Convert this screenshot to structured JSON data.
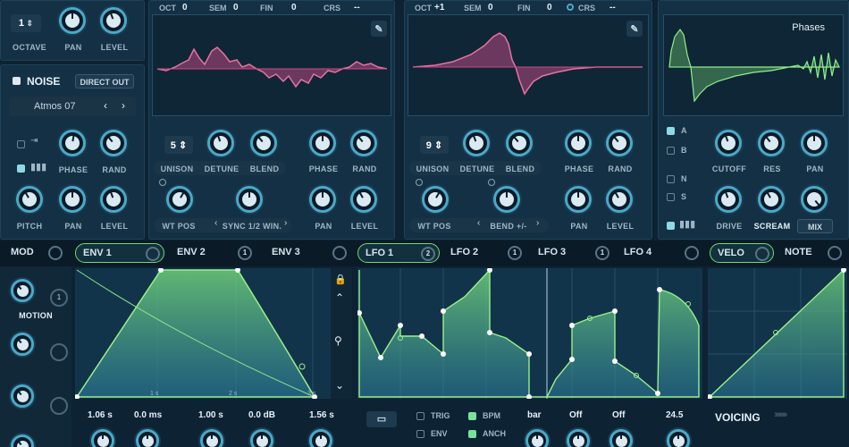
{
  "top_left": {
    "octave_value": "1",
    "octave_label": "OCTAVE",
    "pan_label": "PAN",
    "level_label": "LEVEL",
    "noise_label": "NOISE",
    "direct_out_label": "DIRECT OUT",
    "preset_name": "Atmos 07",
    "phase_label": "PHASE",
    "rand_label": "RAND",
    "pitch_label": "PITCH",
    "pan2_label": "PAN",
    "level2_label": "LEVEL"
  },
  "osc_a": {
    "oct_label": "OCT",
    "oct_value": "0",
    "sem_label": "SEM",
    "sem_value": "0",
    "fin_label": "FIN",
    "fin_value": "0",
    "crs_label": "CRS",
    "crs_value": "--",
    "unison_value": "5",
    "unison_label": "UNISON",
    "detune_label": "DETUNE",
    "blend_label": "BLEND",
    "phase_label": "PHASE",
    "rand_label": "RAND",
    "wt_pos_label": "WT POS",
    "warp_label": "SYNC 1/2 WIN.",
    "pan_label": "PAN",
    "level_label": "LEVEL"
  },
  "osc_b": {
    "oct_label": "OCT",
    "oct_value": "+1",
    "sem_label": "SEM",
    "sem_value": "0",
    "fin_label": "FIN",
    "fin_value": "0",
    "crs_label": "CRS",
    "crs_value": "--",
    "unison_value": "9",
    "unison_label": "UNISON",
    "detune_label": "DETUNE",
    "blend_label": "BLEND",
    "phase_label": "PHASE",
    "rand_label": "RAND",
    "wt_pos_label": "WT POS",
    "warp_label": "BEND +/-",
    "pan_label": "PAN",
    "level_label": "LEVEL"
  },
  "filter": {
    "title": "Phases",
    "a_label": "A",
    "b_label": "B",
    "n_label": "N",
    "s_label": "S",
    "cutoff_label": "CUTOFF",
    "res_label": "RES",
    "pan_label": "PAN",
    "drive_label": "DRIVE",
    "scream_label": "SCREAM",
    "mix_label": "MIX"
  },
  "mod_tabs": [
    {
      "label": "MOD",
      "badge": ""
    },
    {
      "label": "ENV 1",
      "badge": ""
    },
    {
      "label": "ENV 2",
      "badge": "1"
    },
    {
      "label": "ENV 3",
      "badge": ""
    },
    {
      "label": "LFO 1",
      "badge": "2"
    },
    {
      "label": "LFO 2",
      "badge": "1"
    },
    {
      "label": "LFO 3",
      "badge": "1"
    },
    {
      "label": "LFO 4",
      "badge": ""
    },
    {
      "label": "VELO",
      "badge": ""
    },
    {
      "label": "NOTE",
      "badge": ""
    }
  ],
  "macro": {
    "motion_label": "MOTION",
    "badge": "1"
  },
  "env": {
    "time_labels": [
      "1 s",
      "2 s",
      "3 s"
    ],
    "attack_value": "1.06 s",
    "hold_value": "0.0 ms",
    "decay_value": "1.00 s",
    "sustain_value": "0.0 dB",
    "release_value": "1.56 s"
  },
  "lfo": {
    "trig_label": "TRIG",
    "env_label": "ENV",
    "bpm_label": "BPM",
    "anch_label": "ANCH",
    "rate_value": "bar",
    "rise_value": "Off",
    "delay_value": "Off",
    "smooth_value": "24.5"
  },
  "voicing": {
    "title": "VOICING"
  },
  "colors": {
    "accent": "#4aa9c8",
    "wave": "#c84a87",
    "env": "#7fe07a",
    "bg": "#0d2233"
  }
}
